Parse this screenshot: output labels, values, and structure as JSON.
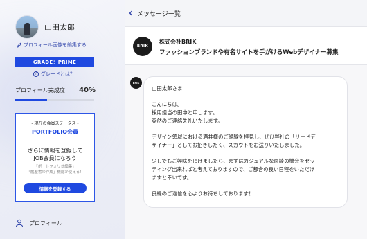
{
  "user": {
    "name": "山田太郎",
    "edit_profile_label": "プロフィール画像を編集する"
  },
  "grade": {
    "badge": "GRADE：PRIME",
    "help_label": "グレードとは？"
  },
  "profile_completion": {
    "label": "プロフィール完成度",
    "value_label": "40%",
    "fraction": 0.4
  },
  "membership": {
    "status_label": "- 現在の会員ステータス -",
    "tier": "PORTFOLIO会員",
    "pitch_line1": "さらに情報を登録して",
    "pitch_line2": "JOB会員になろう",
    "perks_line1": "「ポートフォリオ編集」",
    "perks_line2": "「履歴書の作成」機能が使える！",
    "register_button": "情報を登録する"
  },
  "nav": {
    "profile": "プロフィール"
  },
  "topbar": {
    "title": "メッセージ一覧"
  },
  "thread": {
    "logo_text": "BRIK",
    "company": "株式会社BRIK",
    "job_title": "ファッションブランドや有名サイトを手がけるWebデザイナー募集"
  },
  "message": {
    "salutation": "山田太郎さま",
    "greeting": "こんにちは。",
    "intro": "採用担当の田中と申します。",
    "apology": "突然のご連絡失礼いたします。",
    "body1": "デザイン領域における酒井様のご経験を拝見し、ぜひ弊社の「リードデ\nザイナー」としてお招きしたく、スカウトをお送りいたしました。",
    "body2": "少しでもご興味を頂けましたら、まずはカジュアルな面談の機会をセッ\nティング出来ればと考えておりますので、ご都合の良い日程をいただけ\nますと幸いです。",
    "closing": "良縁のご返信を心よりお待ちしております！"
  },
  "colors": {
    "accent": "#1f49e0",
    "link": "#2a3fa8",
    "logo_bg": "#1b1b1b"
  },
  "icons": {
    "edit": "pencil-icon",
    "help": "question-circle-icon",
    "back": "chevron-left-icon",
    "profile": "person-icon"
  }
}
